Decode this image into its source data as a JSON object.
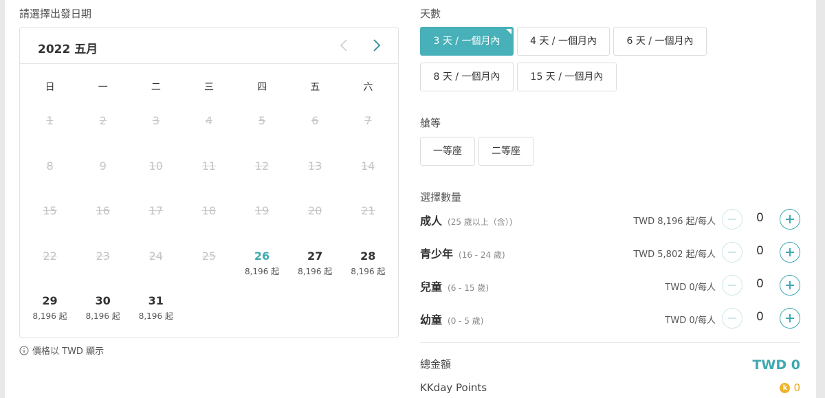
{
  "date_section": {
    "label": "請選擇出發日期",
    "price_note": "價格以 TWD 顯示"
  },
  "calendar": {
    "title": "2022 五月",
    "weekdays": [
      "日",
      "一",
      "二",
      "三",
      "四",
      "五",
      "六"
    ],
    "days": [
      {
        "num": "1",
        "disabled": true,
        "price": ""
      },
      {
        "num": "2",
        "disabled": true,
        "price": ""
      },
      {
        "num": "3",
        "disabled": true,
        "price": ""
      },
      {
        "num": "4",
        "disabled": true,
        "price": ""
      },
      {
        "num": "5",
        "disabled": true,
        "price": ""
      },
      {
        "num": "6",
        "disabled": true,
        "price": ""
      },
      {
        "num": "7",
        "disabled": true,
        "price": ""
      },
      {
        "num": "8",
        "disabled": true,
        "price": ""
      },
      {
        "num": "9",
        "disabled": true,
        "price": ""
      },
      {
        "num": "10",
        "disabled": true,
        "price": ""
      },
      {
        "num": "11",
        "disabled": true,
        "price": ""
      },
      {
        "num": "12",
        "disabled": true,
        "price": ""
      },
      {
        "num": "13",
        "disabled": true,
        "price": ""
      },
      {
        "num": "14",
        "disabled": true,
        "price": ""
      },
      {
        "num": "15",
        "disabled": true,
        "price": ""
      },
      {
        "num": "16",
        "disabled": true,
        "price": ""
      },
      {
        "num": "17",
        "disabled": true,
        "price": ""
      },
      {
        "num": "18",
        "disabled": true,
        "price": ""
      },
      {
        "num": "19",
        "disabled": true,
        "price": ""
      },
      {
        "num": "20",
        "disabled": true,
        "price": ""
      },
      {
        "num": "21",
        "disabled": true,
        "price": ""
      },
      {
        "num": "22",
        "disabled": true,
        "price": ""
      },
      {
        "num": "23",
        "disabled": true,
        "price": ""
      },
      {
        "num": "24",
        "disabled": true,
        "price": ""
      },
      {
        "num": "25",
        "disabled": true,
        "price": ""
      },
      {
        "num": "26",
        "disabled": false,
        "selected": true,
        "price": "8,196 起"
      },
      {
        "num": "27",
        "disabled": false,
        "price": "8,196 起"
      },
      {
        "num": "28",
        "disabled": false,
        "price": "8,196 起"
      },
      {
        "num": "29",
        "disabled": false,
        "price": "8,196 起"
      },
      {
        "num": "30",
        "disabled": false,
        "price": "8,196 起"
      },
      {
        "num": "31",
        "disabled": false,
        "price": "8,196 起"
      }
    ]
  },
  "days_section": {
    "label": "天數",
    "options": [
      "3 天 / 一個月內",
      "4 天 / 一個月內",
      "6 天 / 一個月內",
      "8 天 / 一個月內",
      "15 天 / 一個月內"
    ],
    "selected": "3 天 / 一個月內"
  },
  "class_section": {
    "label": "艙等",
    "options": [
      "一等座",
      "二等座"
    ]
  },
  "quantity_section": {
    "label": "選擇數量",
    "rows": [
      {
        "name": "成人",
        "age": "(25 歲以上（含）)",
        "price": "TWD 8,196 起/每人",
        "qty": "0"
      },
      {
        "name": "青少年",
        "age": "(16 - 24 歲)",
        "price": "TWD 5,802 起/每人",
        "qty": "0"
      },
      {
        "name": "兒童",
        "age": "(6 - 15 歲)",
        "price": "TWD 0/每人",
        "qty": "0"
      },
      {
        "name": "幼童",
        "age": "(0 - 5 歲)",
        "price": "TWD 0/每人",
        "qty": "0"
      }
    ]
  },
  "total": {
    "label": "總金額",
    "value": "TWD 0"
  },
  "points": {
    "label": "KKday Points",
    "coin": "k",
    "value": "0"
  },
  "colors": {
    "accent": "#48b0b8",
    "disabled_text": "#c5c5c5",
    "points": "#f0b429"
  },
  "icons": {
    "prev": "chevron-left-icon",
    "next": "chevron-right-icon",
    "info": "info-circle-icon"
  }
}
